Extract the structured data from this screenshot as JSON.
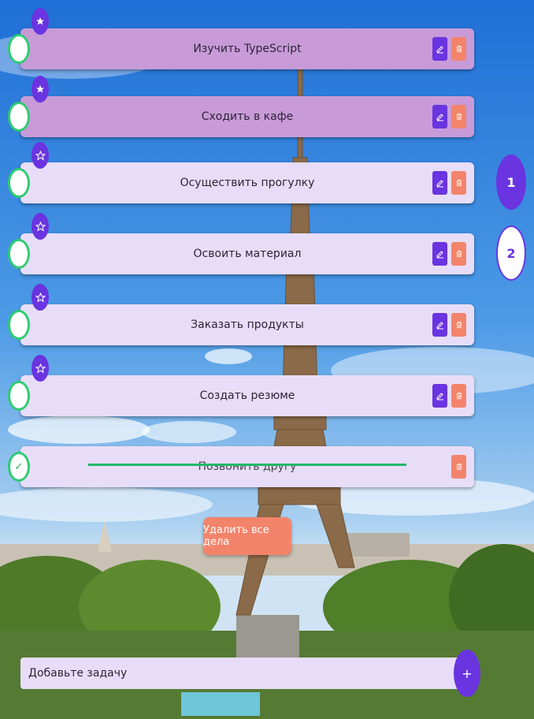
{
  "todo": {
    "tasks": [
      {
        "text": "Изучить TypeScript",
        "favorite": true,
        "done": false
      },
      {
        "text": "Сходить в кафе",
        "favorite": true,
        "done": false
      },
      {
        "text": "Осуществить прогулку",
        "favorite": false,
        "done": false
      },
      {
        "text": "Освоить материал",
        "favorite": false,
        "done": false
      },
      {
        "text": "Заказать продукты",
        "favorite": false,
        "done": false
      },
      {
        "text": "Создать резюме",
        "favorite": false,
        "done": false
      },
      {
        "text": "Позвонить другу",
        "favorite": false,
        "done": true
      }
    ],
    "check_mark": "✓",
    "pagination": {
      "pages": [
        "1",
        "2"
      ],
      "current": "1"
    },
    "delete_all_label": "Удалить все дела",
    "add_input_placeholder": "Добавьте задачу",
    "add_button_label": "+"
  },
  "colors": {
    "favorite_task": "#c89bd8",
    "task": "#e8ddf8",
    "accent": "#6a34e0",
    "delete": "#f3846b",
    "check_border": "#2ecc71"
  },
  "icons": {
    "favorite": "star-filled-icon",
    "not_favorite": "star-outline-icon",
    "edit": "pencil-icon",
    "delete": "trash-icon",
    "done": "check-icon"
  }
}
